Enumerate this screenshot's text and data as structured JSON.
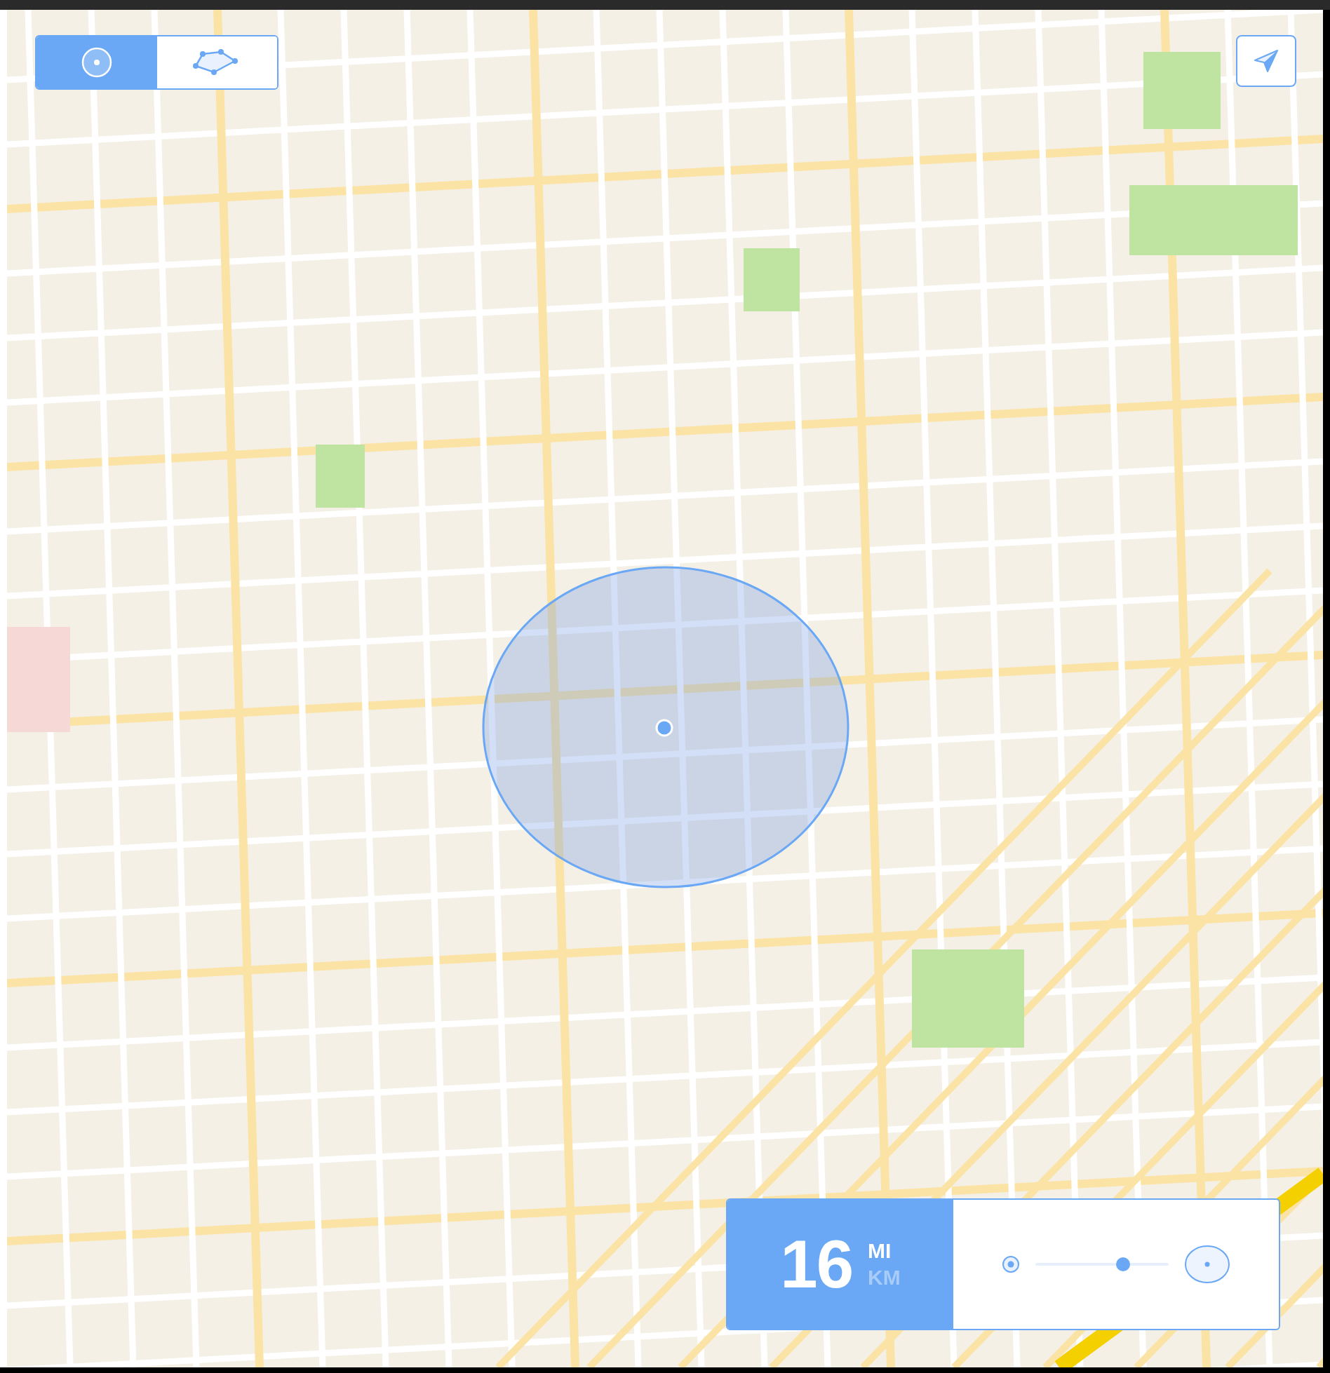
{
  "mode_toggle": [
    {
      "kind": "radius",
      "selected": true
    },
    {
      "kind": "polygon",
      "selected": false
    }
  ],
  "radius_panel": {
    "value": "16",
    "units": [
      {
        "label": "MI",
        "selected": true
      },
      {
        "label": "KM",
        "selected": false
      }
    ],
    "slider": {
      "level": 0.66
    }
  }
}
